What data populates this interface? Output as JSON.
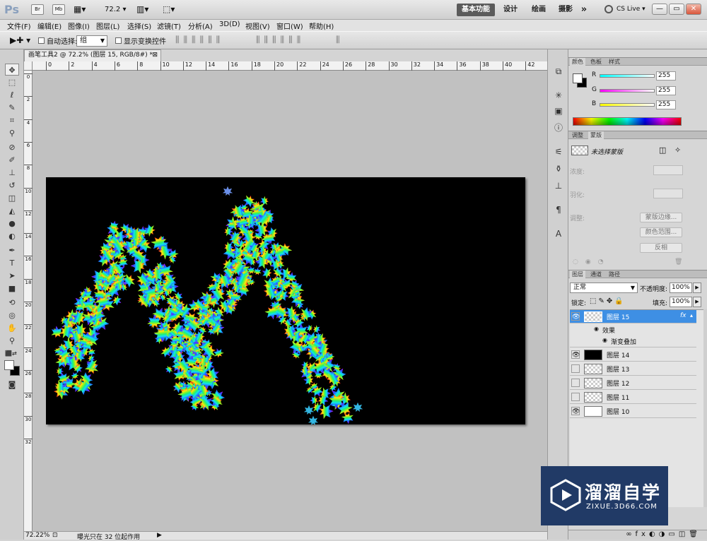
{
  "app": {
    "logo": "Ps",
    "toolbar_zoom": "72.2",
    "workspaces": [
      "基本功能",
      "设计",
      "绘画",
      "摄影"
    ],
    "more": "»",
    "cs_live": "CS Live",
    "win_controls": [
      "—",
      "▭",
      "✕"
    ]
  },
  "menu": [
    "文件(F)",
    "编辑(E)",
    "图像(I)",
    "图层(L)",
    "选择(S)",
    "滤镜(T)",
    "分析(A)",
    "3D(D)",
    "视图(V)",
    "窗口(W)",
    "帮助(H)"
  ],
  "options": {
    "auto_select_label": "自动选择:",
    "auto_select_value": "组",
    "show_transform_label": "显示变换控件"
  },
  "document": {
    "tab_title": "画笔工具2 @ 72.2% (图层 15, RGB/8#) *",
    "ruler_h": [
      "0",
      "2",
      "4",
      "6",
      "8",
      "10",
      "12",
      "14",
      "16",
      "18",
      "20",
      "22",
      "24",
      "26",
      "28",
      "30",
      "32",
      "34",
      "36",
      "38",
      "40",
      "42"
    ],
    "ruler_v": [
      "0",
      "2",
      "4",
      "6",
      "8",
      "10",
      "12",
      "14",
      "16",
      "18",
      "20",
      "22",
      "24",
      "26",
      "28",
      "30",
      "32"
    ]
  },
  "status": {
    "zoom": "72.22%",
    "info": "曝光只在 32 位起作用"
  },
  "color_panel": {
    "tabs": [
      "颜色",
      "色板",
      "样式"
    ],
    "channels": [
      {
        "label": "R",
        "value": "255",
        "gradient": "linear-gradient(90deg,#00ffff,#ffffff)"
      },
      {
        "label": "G",
        "value": "255",
        "gradient": "linear-gradient(90deg,#ff00ff,#ffffff)"
      },
      {
        "label": "B",
        "value": "255",
        "gradient": "linear-gradient(90deg,#ffff00,#ffffff)"
      }
    ]
  },
  "masks_panel": {
    "tabs": [
      "调整",
      "蒙版"
    ],
    "no_mask": "未选择蒙版",
    "density_label": "浓度:",
    "feather_label": "羽化:",
    "refine_label": "调整:",
    "buttons": [
      "蒙版边缘...",
      "颜色范围...",
      "反相"
    ]
  },
  "layers_panel": {
    "tabs": [
      "图层",
      "通道",
      "路径"
    ],
    "blend_mode": "正常",
    "opacity_label": "不透明度:",
    "opacity": "100%",
    "lock_label": "锁定:",
    "fill_label": "填充:",
    "fill": "100%",
    "effects_label": "效果",
    "gradient_overlay_label": "渐变叠加",
    "fx": "fx",
    "layers": [
      {
        "name": "图层 15",
        "visible": true,
        "selected": true,
        "thumb": "transparent"
      },
      {
        "name": "图层 14",
        "visible": true,
        "selected": false,
        "thumb": "black"
      },
      {
        "name": "图层 13",
        "visible": false,
        "selected": false,
        "thumb": "transparent"
      },
      {
        "name": "图层 12",
        "visible": false,
        "selected": false,
        "thumb": "transparent"
      },
      {
        "name": "图层 11",
        "visible": false,
        "selected": false,
        "thumb": "transparent"
      },
      {
        "name": "图层 10",
        "visible": true,
        "selected": false,
        "thumb": "white"
      }
    ]
  },
  "watermark": {
    "title": "溜溜自学",
    "url": "ZIXUE.3D66.COM"
  }
}
